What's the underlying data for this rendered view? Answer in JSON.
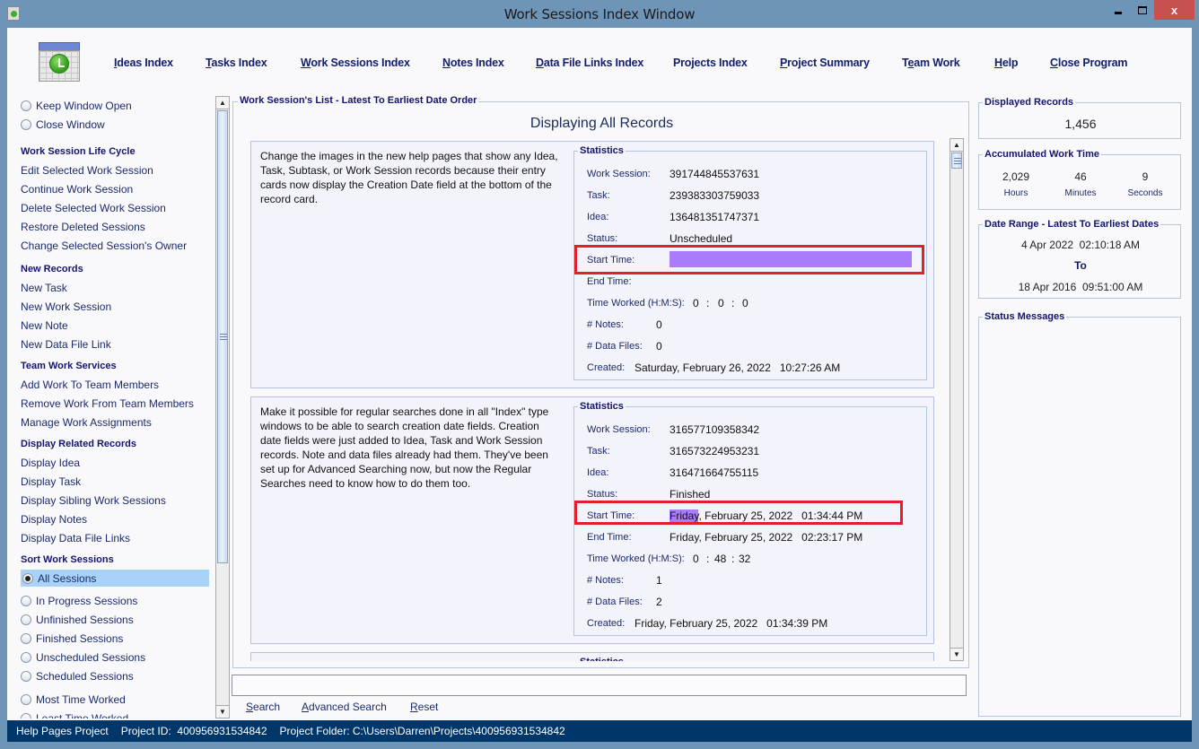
{
  "window": {
    "title": "Work Sessions Index Window",
    "controls": {
      "minimize": "minimize",
      "maximize": "maximize",
      "close": "x"
    }
  },
  "nav": {
    "logo_icon": "calendar-clock-icon",
    "links": [
      {
        "label": "Ideas Index",
        "mnemonic": "I"
      },
      {
        "label": "Tasks Index",
        "mnemonic": "T"
      },
      {
        "label": "Work Sessions Index",
        "mnemonic": "W"
      },
      {
        "label": "Notes Index",
        "mnemonic": "N"
      },
      {
        "label": "Data File Links Index",
        "mnemonic": "D"
      },
      {
        "label": "Projects Index",
        "mnemonic": ""
      },
      {
        "label": "Project Summary",
        "mnemonic": "P"
      },
      {
        "label": "Team Work",
        "mnemonic": "e"
      },
      {
        "label": "Help",
        "mnemonic": "H"
      },
      {
        "label": "Close Program",
        "mnemonic": "C"
      }
    ]
  },
  "left": {
    "window_options": [
      {
        "label": "Keep Window Open",
        "selected": false
      },
      {
        "label": "Close Window",
        "selected": false
      }
    ],
    "sections": [
      {
        "heading": "Work Session Life Cycle",
        "items": [
          "Edit Selected Work Session",
          "Continue Work Session",
          "Delete Selected Work Session",
          "Restore Deleted Sessions",
          "Change Selected Session's Owner"
        ]
      },
      {
        "heading": "New Records",
        "items": [
          "New Task",
          "New Work Session",
          "New Note",
          "New Data File Link"
        ]
      },
      {
        "heading": "Team Work Services",
        "items": [
          "Add Work To Team Members",
          "Remove Work From Team Members",
          "Manage Work Assignments"
        ]
      },
      {
        "heading": "Display Related Records",
        "items": [
          "Display Idea",
          "Display Task",
          "Display Sibling Work Sessions",
          "Display Notes",
          "Display Data File Links"
        ]
      }
    ],
    "sort": {
      "heading": "Sort Work Sessions",
      "options": [
        {
          "label": "All Sessions",
          "selected": true
        },
        {
          "label": "In Progress Sessions",
          "selected": false
        },
        {
          "label": "Unfinished Sessions",
          "selected": false
        },
        {
          "label": "Finished Sessions",
          "selected": false
        },
        {
          "label": "Unscheduled Sessions",
          "selected": false
        },
        {
          "label": "Scheduled Sessions",
          "selected": false
        },
        {
          "label": "Most Time Worked",
          "selected": false
        },
        {
          "label": "Least Time Worked",
          "selected": false
        }
      ]
    }
  },
  "center": {
    "group_title": "Work Session's List - Latest To Earliest Date Order",
    "displaying": "Displaying All Records",
    "stats_title": "Statistics",
    "labels": {
      "work_session": "Work Session:",
      "task": "Task:",
      "idea": "Idea:",
      "status": "Status:",
      "start_time": "Start Time:",
      "end_time": "End Time:",
      "time_worked": "Time Worked (H:M:S):",
      "notes": "# Notes:",
      "data_files": "# Data Files:",
      "created": "Created:"
    },
    "cards": [
      {
        "description": "Change the images in the new help pages that show any Idea, Task, Subtask, or Work Session records because their entry cards now display the Creation Date field at the bottom of the record card.",
        "work_session": "391744845537631",
        "task": "239383303759033",
        "idea": "136481351747371",
        "status": "Unscheduled",
        "start_time": "",
        "start_time_highlighted": true,
        "end_time": "",
        "time_worked": {
          "h": "0",
          "m": "0",
          "s": "0"
        },
        "notes": "0",
        "data_files": "0",
        "created": "Saturday, February 26, 2022   10:27:26 AM"
      },
      {
        "description": "Make it possible for regular searches done in all \"Index\" type windows to be able to search creation date fields. Creation date fields were just added to Idea, Task and Work Session records. Note and data files already had them. They've been set up for Advanced Searching now, but now the Regular Searches need to know how to do them too.",
        "work_session": "316577109358342",
        "task": "316573224953231",
        "idea": "316471664755115",
        "status": "Finished",
        "start_time_day": "Friday",
        "start_time_rest": ", February 25, 2022   01:34:44 PM",
        "end_time": "Friday, February 25, 2022   02:23:17 PM",
        "time_worked": {
          "h": "0",
          "m": "48",
          "s": "32"
        },
        "notes": "1",
        "data_files": "2",
        "created": "Friday, February 25, 2022   01:34:39 PM"
      }
    ],
    "search": {
      "value": "",
      "buttons": [
        {
          "label": "Search",
          "mnemonic": "S"
        },
        {
          "label": "Advanced Search",
          "mnemonic": "A"
        },
        {
          "label": "Reset",
          "mnemonic": "R"
        }
      ]
    }
  },
  "right": {
    "displayed_records": {
      "title": "Displayed Records",
      "value": "1,456"
    },
    "accumulated": {
      "title": "Accumulated Work Time",
      "hours": "2,029",
      "minutes": "46",
      "seconds": "9",
      "hours_label": "Hours",
      "minutes_label": "Minutes",
      "seconds_label": "Seconds"
    },
    "date_range": {
      "title": "Date Range - Latest To Earliest Dates",
      "latest": "4 Apr 2022  02:10:18 AM",
      "to": "To",
      "earliest": "18 Apr 2016  09:51:00 AM"
    },
    "status_messages": {
      "title": "Status Messages",
      "text": ""
    }
  },
  "statusbar": {
    "project_name": "Help Pages Project",
    "project_id": "Project ID:  400956931534842",
    "project_folder": "Project Folder: C:\\Users\\Darren\\Projects\\400956931534842"
  },
  "colors": {
    "titlebar": "#6e95b8",
    "statusbar": "#00376a",
    "close_button": "#c75050",
    "highlight": "#a97cfc",
    "annotation_box": "#e0202a",
    "selected_row": "#a8d2f8"
  }
}
